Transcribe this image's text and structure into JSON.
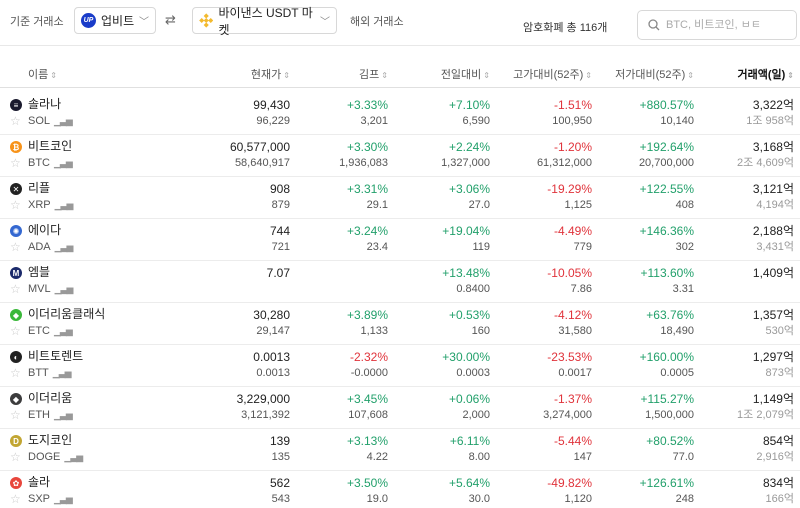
{
  "topbar": {
    "base_exchange_label": "기준 거래소",
    "base_exchange": "업비트",
    "compare_exchange": "바이낸스 USDT 마켓",
    "foreign_exchange_label": "해외 거래소",
    "count_text": "암호화폐 총 116개",
    "search_placeholder": "BTC, 비트코인, ㅂㅌ"
  },
  "columns": {
    "name": "이름",
    "price": "현재가",
    "premium": "김프",
    "change": "전일대비",
    "high52": "고가대비(52주)",
    "low52": "저가대비(52주)",
    "volume": "거래액(일)"
  },
  "colors": {
    "up": "#22a06b",
    "down": "#e0333b"
  },
  "rows": [
    {
      "name": "솔라나",
      "symbol": "SOL",
      "icon": "solana-icon",
      "icon_char": "≡",
      "icon_color": "#1a1a2e",
      "price": "99,430",
      "price2": "96,229",
      "premium": "+3.33%",
      "premium2": "3,201",
      "premium_dir": "up",
      "change": "+7.10%",
      "change2": "6,590",
      "change_dir": "up",
      "high": "-1.51%",
      "high2": "100,950",
      "low": "+880.57%",
      "low2": "10,140",
      "vol": "3,322억",
      "vol2": "1조 958억"
    },
    {
      "name": "비트코인",
      "symbol": "BTC",
      "icon": "bitcoin-icon",
      "icon_char": "₿",
      "icon_color": "#f7931a",
      "price": "60,577,000",
      "price2": "58,640,917",
      "premium": "+3.30%",
      "premium2": "1,936,083",
      "premium_dir": "up",
      "change": "+2.24%",
      "change2": "1,327,000",
      "change_dir": "up",
      "high": "-1.20%",
      "high2": "61,312,000",
      "low": "+192.64%",
      "low2": "20,700,000",
      "vol": "3,168억",
      "vol2": "2조 4,609억"
    },
    {
      "name": "리플",
      "symbol": "XRP",
      "icon": "ripple-icon",
      "icon_char": "✕",
      "icon_color": "#222222",
      "price": "908",
      "price2": "879",
      "premium": "+3.31%",
      "premium2": "29.1",
      "premium_dir": "up",
      "change": "+3.06%",
      "change2": "27.0",
      "change_dir": "up",
      "high": "-19.29%",
      "high2": "1,125",
      "low": "+122.55%",
      "low2": "408",
      "vol": "3,121억",
      "vol2": "4,194억"
    },
    {
      "name": "에이다",
      "symbol": "ADA",
      "icon": "cardano-icon",
      "icon_char": "✺",
      "icon_color": "#3468d1",
      "price": "744",
      "price2": "721",
      "premium": "+3.24%",
      "premium2": "23.4",
      "premium_dir": "up",
      "change": "+19.04%",
      "change2": "119",
      "change_dir": "up",
      "high": "-4.49%",
      "high2": "779",
      "low": "+146.36%",
      "low2": "302",
      "vol": "2,188억",
      "vol2": "3,431억"
    },
    {
      "name": "엠블",
      "symbol": "MVL",
      "icon": "mvl-icon",
      "icon_char": "M",
      "icon_color": "#1b2a6b",
      "price": "7.07",
      "price2": "",
      "premium": "",
      "premium2": "",
      "premium_dir": "up",
      "change": "+13.48%",
      "change2": "0.8400",
      "change_dir": "up",
      "high": "-10.05%",
      "high2": "7.86",
      "low": "+113.60%",
      "low2": "3.31",
      "vol": "1,409억",
      "vol2": ""
    },
    {
      "name": "이더리움클래식",
      "symbol": "ETC",
      "icon": "ethereum-classic-icon",
      "icon_char": "◆",
      "icon_color": "#3ab83a",
      "price": "30,280",
      "price2": "29,147",
      "premium": "+3.89%",
      "premium2": "1,133",
      "premium_dir": "up",
      "change": "+0.53%",
      "change2": "160",
      "change_dir": "up",
      "high": "-4.12%",
      "high2": "31,580",
      "low": "+63.76%",
      "low2": "18,490",
      "vol": "1,357억",
      "vol2": "530억"
    },
    {
      "name": "비트토렌트",
      "symbol": "BTT",
      "icon": "bittorrent-icon",
      "icon_char": "◐",
      "icon_color": "#222222",
      "price": "0.0013",
      "price2": "0.0013",
      "premium": "-2.32%",
      "premium2": "-0.0000",
      "premium_dir": "down",
      "change": "+30.00%",
      "change2": "0.0003",
      "change_dir": "up",
      "high": "-23.53%",
      "high2": "0.0017",
      "low": "+160.00%",
      "low2": "0.0005",
      "vol": "1,297억",
      "vol2": "873억"
    },
    {
      "name": "이더리움",
      "symbol": "ETH",
      "icon": "ethereum-icon",
      "icon_char": "◆",
      "icon_color": "#3c3c3d",
      "price": "3,229,000",
      "price2": "3,121,392",
      "premium": "+3.45%",
      "premium2": "107,608",
      "premium_dir": "up",
      "change": "+0.06%",
      "change2": "2,000",
      "change_dir": "up",
      "high": "-1.37%",
      "high2": "3,274,000",
      "low": "+115.27%",
      "low2": "1,500,000",
      "vol": "1,149억",
      "vol2": "1조 2,079억"
    },
    {
      "name": "도지코인",
      "symbol": "DOGE",
      "icon": "dogecoin-icon",
      "icon_char": "D",
      "icon_color": "#c2a633",
      "price": "139",
      "price2": "135",
      "premium": "+3.13%",
      "premium2": "4.22",
      "premium_dir": "up",
      "change": "+6.11%",
      "change2": "8.00",
      "change_dir": "up",
      "high": "-5.44%",
      "high2": "147",
      "low": "+80.52%",
      "low2": "77.0",
      "vol": "854억",
      "vol2": "2,916억"
    },
    {
      "name": "솔라",
      "symbol": "SXP",
      "icon": "swipe-icon",
      "icon_char": "✿",
      "icon_color": "#e8463c",
      "price": "562",
      "price2": "543",
      "premium": "+3.50%",
      "premium2": "19.0",
      "premium_dir": "up",
      "change": "+5.64%",
      "change2": "30.0",
      "change_dir": "up",
      "high": "-49.82%",
      "high2": "1,120",
      "low": "+126.61%",
      "low2": "248",
      "vol": "834억",
      "vol2": "166억"
    }
  ]
}
